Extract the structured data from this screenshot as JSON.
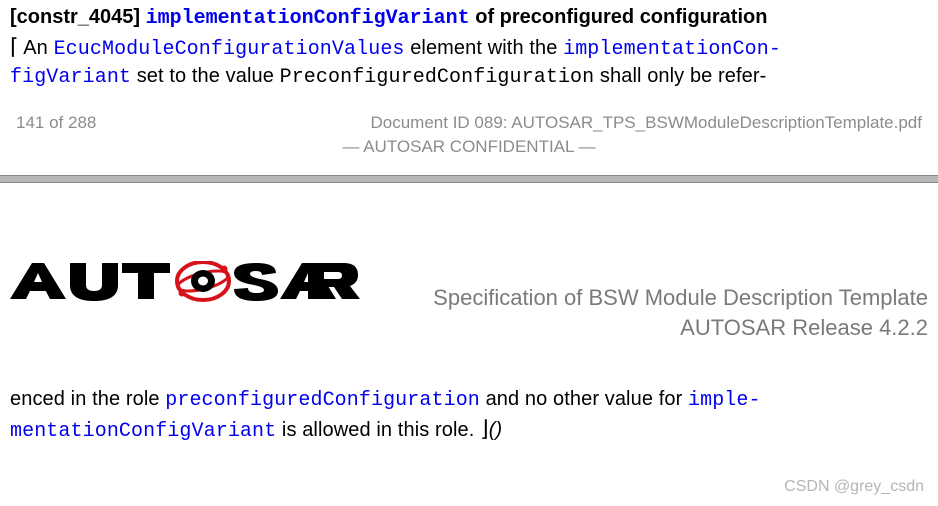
{
  "constraint": {
    "id": "[constr_4045]",
    "code_title": "implementationConfigVariant",
    "title_suffix": " of preconfigured configuration"
  },
  "para1": {
    "open_bracket": "⌈",
    "t1": " An ",
    "code1": "EcucModuleConfigurationValues",
    "t2": " element with the ",
    "code2": "implementationCon-",
    "code2b": "figVariant",
    "t3": " set to the value ",
    "code3": "PreconfiguredConfiguration",
    "t4": " shall only be refer-"
  },
  "footer": {
    "page": "141 of 288",
    "docid": "Document ID 089: AUTOSAR_TPS_BSWModuleDescriptionTemplate.pdf",
    "confidential": "— AUTOSAR CONFIDENTIAL —"
  },
  "header": {
    "line1": "Specification of BSW Module Description Template",
    "line2": "AUTOSAR Release 4.2.2"
  },
  "para2": {
    "t1": "enced in the role ",
    "code1": "preconfiguredConfiguration",
    "t2": " and no other value for ",
    "code2": "imple-",
    "code2b": "mentationConfigVariant",
    "t3": " is allowed in this role. ",
    "close_bracket": "⌋",
    "trail": "()"
  },
  "watermark": "CSDN @grey_csdn"
}
